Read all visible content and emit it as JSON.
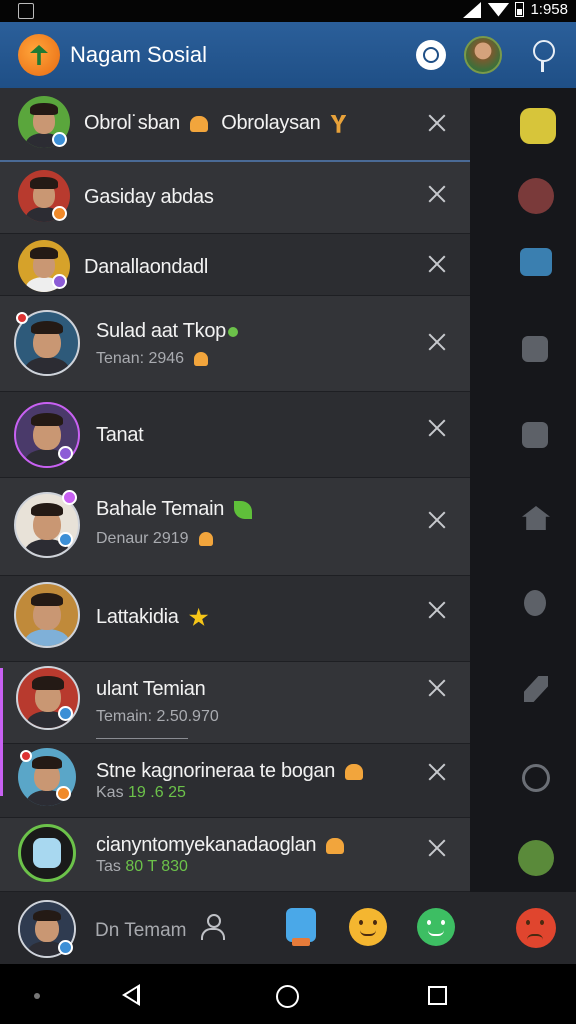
{
  "statusbar": {
    "time": "1:958"
  },
  "app": {
    "title": "Nagam Sosial"
  },
  "chats": [
    {
      "name": "Obrol˙sban",
      "name_tail": "Obrolaysan",
      "subtitle": "",
      "sub_green": "",
      "emoji": "bell"
    },
    {
      "name": "Gasiday abdas",
      "subtitle": "",
      "sub_green": "",
      "emoji": ""
    },
    {
      "name": "Danallaondadl",
      "subtitle": "",
      "sub_green": "",
      "emoji": ""
    },
    {
      "name": "Sulad aat Tkop",
      "subtitle": "Tenan: 2946",
      "sub_green": "",
      "emoji": "dot"
    },
    {
      "name": "Tanat",
      "subtitle": "",
      "sub_green": "",
      "emoji": ""
    },
    {
      "name": "Bahale Temain",
      "subtitle": "Denaur 2919",
      "sub_green": "",
      "emoji": "leaf"
    },
    {
      "name": "Lattakidia",
      "subtitle": "",
      "sub_green": "",
      "emoji": "star"
    },
    {
      "name": "ulant Temian",
      "subtitle": "Temain: 2.50.970",
      "sub_green": "",
      "emoji": ""
    },
    {
      "name": "Stne kagnorineraa te bogan",
      "subtitle": "Kas",
      "sub_green": "19 .6 25",
      "emoji": "bell"
    },
    {
      "name": "cianyntomyekanadaoglan",
      "subtitle": "Tas",
      "sub_green": "80 T 830",
      "emoji": "bell"
    }
  ],
  "input": {
    "placeholder": "Dn Temam"
  },
  "colors": {
    "header": "#1f4f86",
    "drawer": "#2c2d31",
    "accent": "#c861f2",
    "online": "#6cc24a"
  }
}
